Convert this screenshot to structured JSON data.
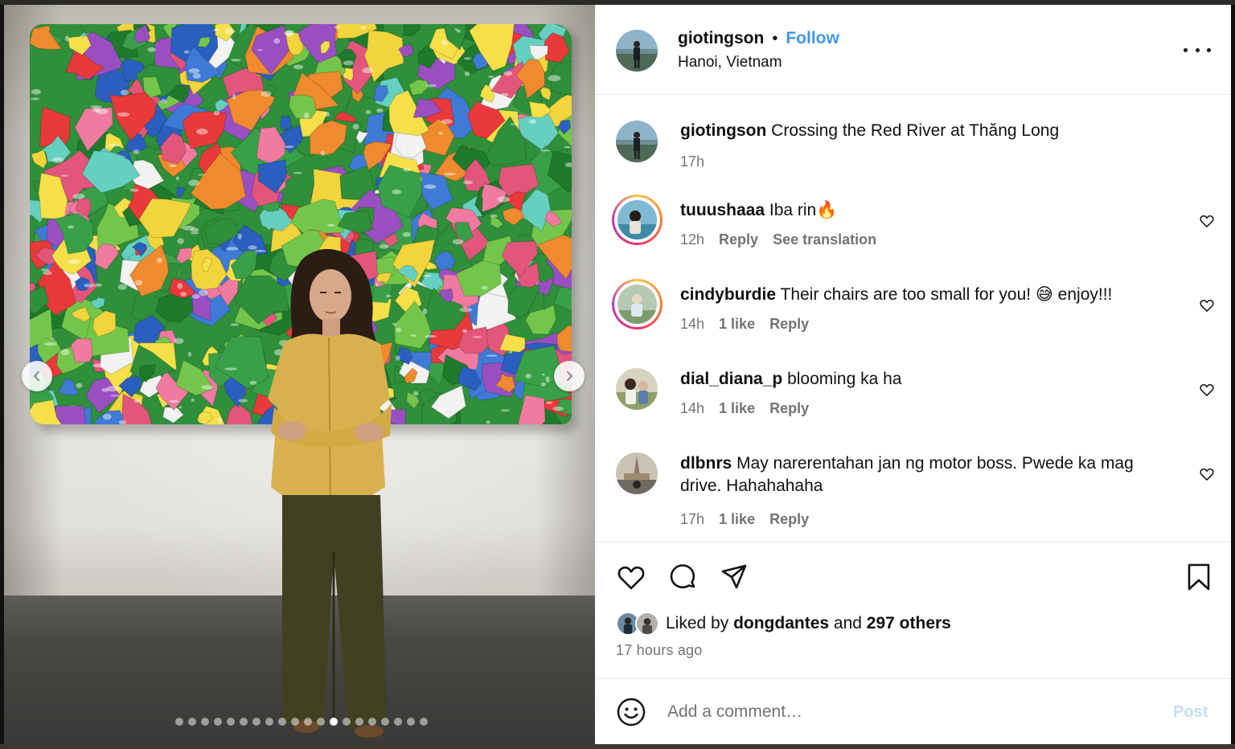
{
  "post": {
    "username": "giotingson",
    "separator": "•",
    "follow_label": "Follow",
    "location": "Hanoi, Vietnam",
    "caption_user": "giotingson",
    "caption_text": "Crossing the Red River at Thăng Long",
    "caption_time": "17h"
  },
  "carousel": {
    "slide_count": 20,
    "active_slide": 13
  },
  "comments": [
    {
      "user": "tuuushaaa",
      "text": "Iba rin🔥",
      "time": "12h",
      "actions": [
        "Reply",
        "See translation"
      ]
    },
    {
      "user": "cindyburdie",
      "text": "Their chairs are too small for you! 😅 enjoy!!!",
      "time": "14h",
      "actions": [
        "1 like",
        "Reply"
      ]
    },
    {
      "user": "dial_diana_p",
      "text": "blooming ka ha",
      "time": "14h",
      "actions": [
        "1 like",
        "Reply"
      ]
    },
    {
      "user": "dlbnrs",
      "text": "May narerentahan jan ng motor boss. Pwede ka mag drive. Hahahahaha",
      "time": "17h",
      "actions": [
        "1 like",
        "Reply"
      ]
    }
  ],
  "likes": {
    "prefix": "Liked by",
    "user": "dongdantes",
    "joiner": "and",
    "others": "297 others"
  },
  "post_time": "17 hours ago",
  "comment_box": {
    "placeholder": "Add a comment…",
    "post_label": "Post"
  },
  "icons": {
    "more": "more-options-icon",
    "like": "heart-icon",
    "comment": "comment-icon",
    "share": "share-icon",
    "save": "bookmark-icon",
    "emoji": "emoji-icon",
    "prev": "chevron-left-icon",
    "next": "chevron-right-icon"
  },
  "colors": {
    "follow": "#4596e4",
    "muted": "#737373",
    "post_disabled": "#c5def5"
  }
}
